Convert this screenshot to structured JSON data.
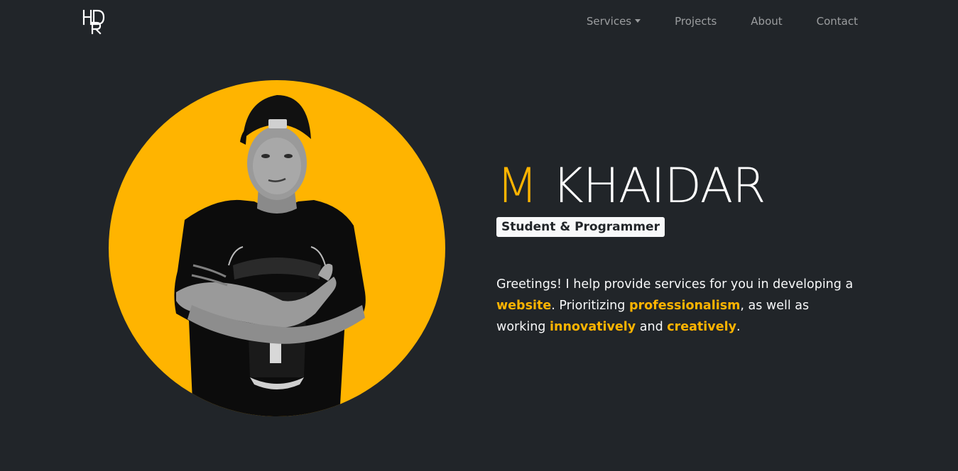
{
  "nav": {
    "brand": "HDR",
    "links": [
      {
        "label": "Services",
        "has_dropdown": true
      },
      {
        "label": "Projects"
      },
      {
        "label": "About"
      },
      {
        "label": "Contact"
      }
    ]
  },
  "hero": {
    "name_first": "M",
    "name_last": "KHAIDAR",
    "role": "Student & Programmer",
    "description": {
      "p1": "Greetings! I help provide services for you in developing a ",
      "h1": "website",
      "p2": ". Prioritizing ",
      "h2": "professionalism",
      "p3": ", as well as working ",
      "h3": "innovatively",
      "p4": " and ",
      "h4": "creatively",
      "p5": "."
    },
    "photo_alt": "portrait photo"
  },
  "colors": {
    "background": "#212529",
    "accent": "#ffb400",
    "nav_text": "rgba(255,255,255,0.55)",
    "badge_bg": "#f8f9fa"
  }
}
